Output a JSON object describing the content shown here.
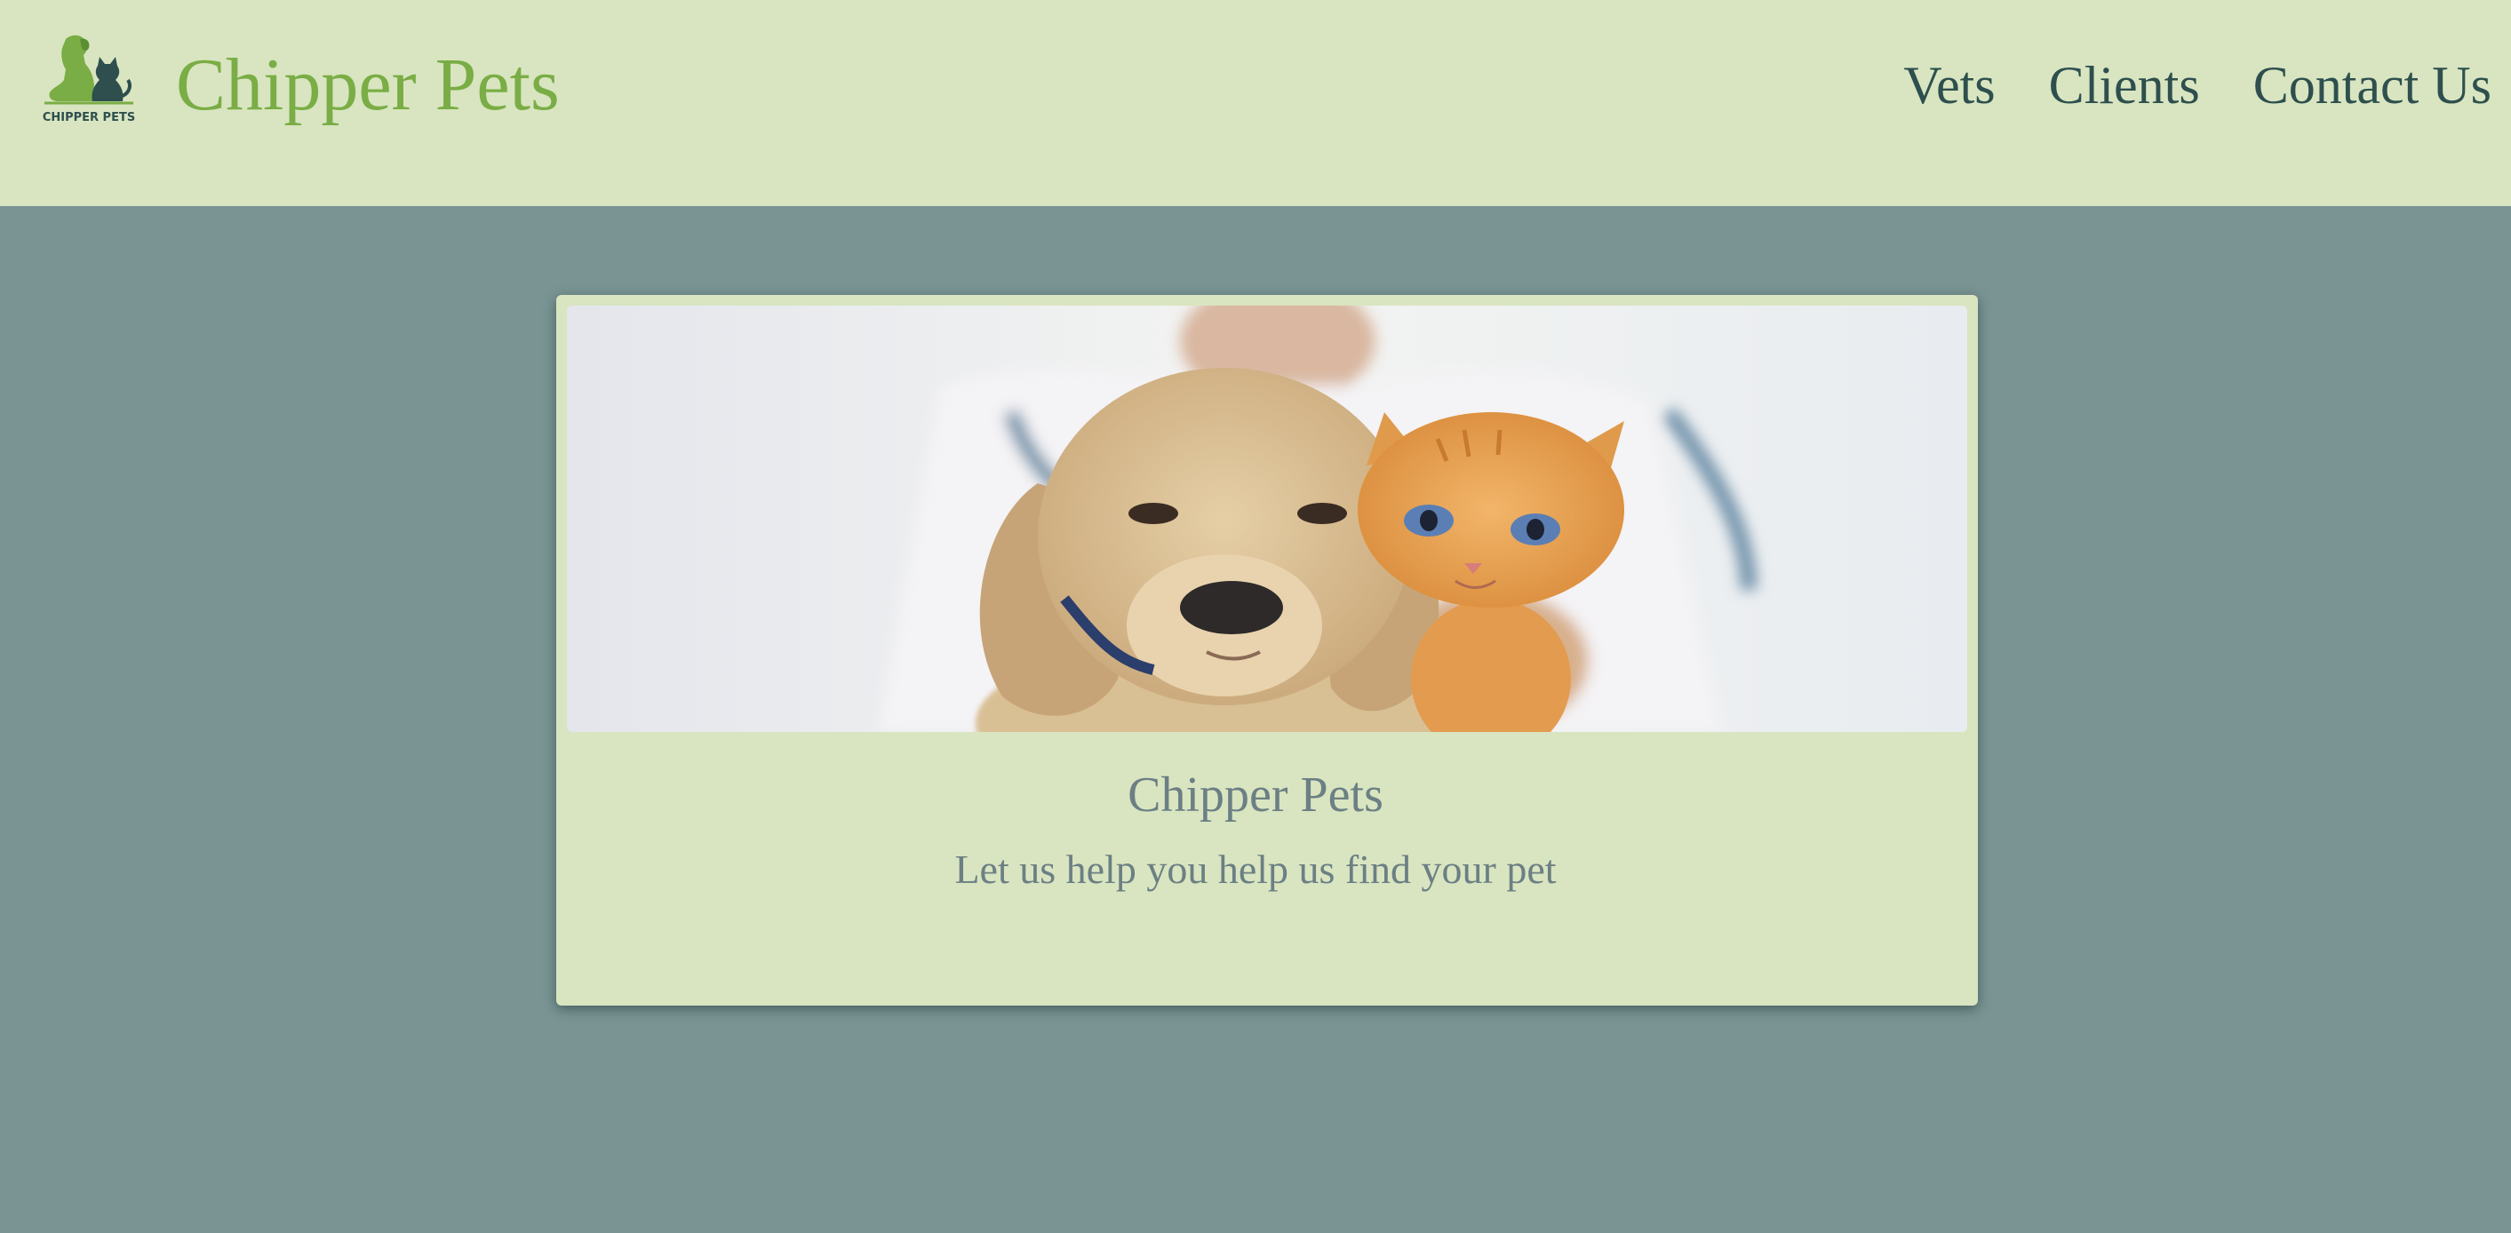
{
  "header": {
    "logo_text": "CHIPPER PETS",
    "brand_title": "Chipper Pets",
    "nav": [
      {
        "label": "Vets"
      },
      {
        "label": "Clients"
      },
      {
        "label": "Contact Us"
      }
    ]
  },
  "hero_card": {
    "image_description_icon": "dog-and-kitten-photo",
    "title": "Chipper Pets",
    "subtitle": "Let us help you help us find your pet"
  },
  "colors": {
    "header_bg": "#d8e5c0",
    "page_bg": "#7a9494",
    "brand_green": "#7aad45",
    "nav_text": "#2e4f4e",
    "card_text": "#6c7f84"
  }
}
